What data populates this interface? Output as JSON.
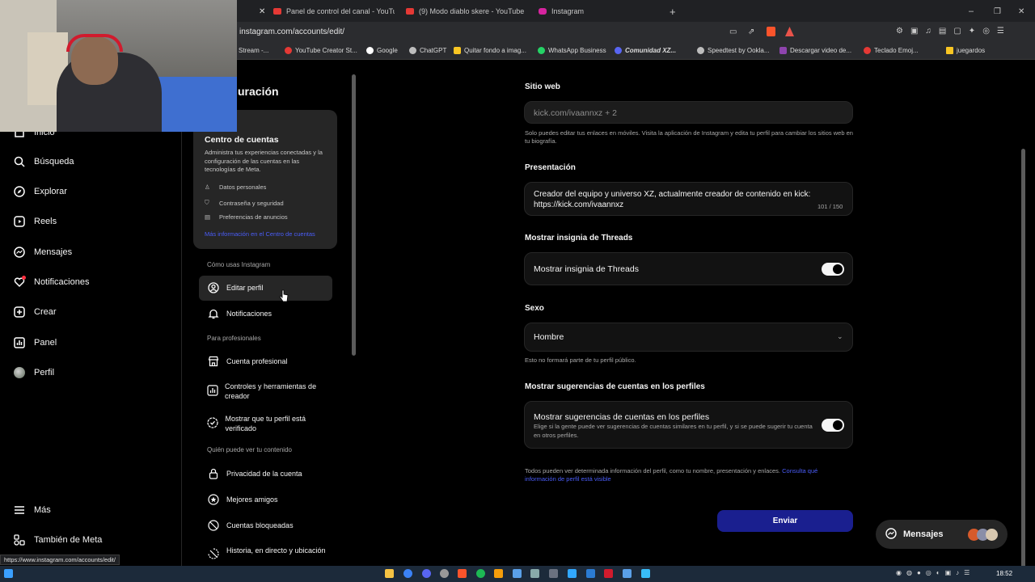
{
  "browser": {
    "tabs": [
      {
        "label": "Panel de control del canal - YouTube",
        "color": "#e53935"
      },
      {
        "label": "(9) Modo diablo skere - YouTube",
        "color": "#e53935"
      },
      {
        "label": "Instagram",
        "color": "#d6249f"
      }
    ],
    "new_tab": "+",
    "url": "instagram.com/accounts/edit/",
    "bookmarks": [
      {
        "label": "Stream -...",
        "color": "#9e9e9e"
      },
      {
        "label": "YouTube Creator St...",
        "color": "#e53935"
      },
      {
        "label": "Google",
        "color": "#ffffff"
      },
      {
        "label": "ChatGPT",
        "color": "#bdbdbd"
      },
      {
        "label": "Quitar fondo a imag...",
        "color": "#f9c623"
      },
      {
        "label": "WhatsApp Business",
        "color": "#25d366"
      },
      {
        "label": "Comunidad XZ...",
        "color": "#5865f2"
      },
      {
        "label": "Speedtest by Ookla...",
        "color": "#bdbdbd"
      },
      {
        "label": "Descargar video de...",
        "color": "#8e44ad"
      },
      {
        "label": "Teclado Emoj...",
        "color": "#e53935"
      },
      {
        "label": "juegardos",
        "color": "#f9c623"
      }
    ]
  },
  "nav": {
    "home": "Inicio",
    "search": "Búsqueda",
    "explore": "Explorar",
    "reels": "Reels",
    "messages": "Mensajes",
    "notifications": "Notificaciones",
    "create": "Crear",
    "panel": "Panel",
    "profile": "Perfil",
    "more": "Más",
    "meta": "También de Meta"
  },
  "settings": {
    "title": "Configuración",
    "title_visible": "uración",
    "accounts_center": {
      "title": "Centro de cuentas",
      "desc": "Administra tus experiencias conectadas y la configuración de las cuentas en las tecnologías de Meta.",
      "items": [
        "Datos personales",
        "Contraseña y seguridad",
        "Preferencias de anuncios"
      ],
      "link": "Más información en el Centro de cuentas"
    },
    "section_how": "Cómo usas Instagram",
    "edit_profile": "Editar perfil",
    "notifications": "Notificaciones",
    "section_pro": "Para profesionales",
    "pro_account": "Cuenta profesional",
    "creator_tools": "Controles y herramientas de creador",
    "verified": "Mostrar que tu perfil está verificado",
    "section_who": "Quién puede ver tu contenido",
    "privacy": "Privacidad de la cuenta",
    "close_friends": "Mejores amigos",
    "blocked": "Cuentas bloqueadas",
    "live": "Historia, en directo y ubicación"
  },
  "form": {
    "website_label": "Sitio web",
    "website_value": "kick.com/ivaannxz + 2",
    "website_note": "Solo puedes editar tus enlaces en móviles. Visita la aplicación de Instagram y edita tu perfil para cambiar los sitios web en tu biografía.",
    "bio_label": "Presentación",
    "bio_value": "Creador del equipo y universo XZ, actualmente creador de contenido en kick: https://kick.com/ivaannxz",
    "bio_count": "101 / 150",
    "threads_label": "Mostrar insignia de Threads",
    "threads_toggle": "Mostrar insignia de Threads",
    "threads_on": true,
    "gender_label": "Sexo",
    "gender_value": "Hombre",
    "gender_note": "Esto no formará parte de tu perfil público.",
    "suggest_label": "Mostrar sugerencias de cuentas en los perfiles",
    "suggest_toggle": "Mostrar sugerencias de cuentas en los perfiles",
    "suggest_desc": "Elige si la gente puede ver sugerencias de cuentas similares en tu perfil, y si se puede sugerir tu cuenta en otros perfiles.",
    "suggest_on": true,
    "footer_note": "Todos pueden ver determinada información del perfil, como tu nombre, presentación y enlaces.",
    "footer_link": "Consulta qué información de perfil está visible",
    "submit": "Enviar"
  },
  "messages_bar": {
    "label": "Mensajes"
  },
  "status_url": "https://www.instagram.com/accounts/edit/",
  "clock": "18:52",
  "colors": {
    "accent_link": "#4a5df9",
    "submit": "#1a1f8f",
    "background": "#000000",
    "card": "#262626"
  }
}
